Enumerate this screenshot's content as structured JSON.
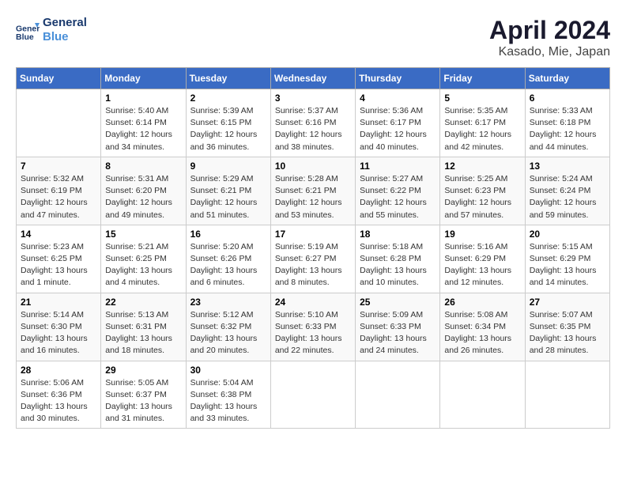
{
  "header": {
    "logo_line1": "General",
    "logo_line2": "Blue",
    "month": "April 2024",
    "location": "Kasado, Mie, Japan"
  },
  "weekdays": [
    "Sunday",
    "Monday",
    "Tuesday",
    "Wednesday",
    "Thursday",
    "Friday",
    "Saturday"
  ],
  "weeks": [
    [
      {
        "day": "",
        "info": ""
      },
      {
        "day": "1",
        "info": "Sunrise: 5:40 AM\nSunset: 6:14 PM\nDaylight: 12 hours\nand 34 minutes."
      },
      {
        "day": "2",
        "info": "Sunrise: 5:39 AM\nSunset: 6:15 PM\nDaylight: 12 hours\nand 36 minutes."
      },
      {
        "day": "3",
        "info": "Sunrise: 5:37 AM\nSunset: 6:16 PM\nDaylight: 12 hours\nand 38 minutes."
      },
      {
        "day": "4",
        "info": "Sunrise: 5:36 AM\nSunset: 6:17 PM\nDaylight: 12 hours\nand 40 minutes."
      },
      {
        "day": "5",
        "info": "Sunrise: 5:35 AM\nSunset: 6:17 PM\nDaylight: 12 hours\nand 42 minutes."
      },
      {
        "day": "6",
        "info": "Sunrise: 5:33 AM\nSunset: 6:18 PM\nDaylight: 12 hours\nand 44 minutes."
      }
    ],
    [
      {
        "day": "7",
        "info": "Sunrise: 5:32 AM\nSunset: 6:19 PM\nDaylight: 12 hours\nand 47 minutes."
      },
      {
        "day": "8",
        "info": "Sunrise: 5:31 AM\nSunset: 6:20 PM\nDaylight: 12 hours\nand 49 minutes."
      },
      {
        "day": "9",
        "info": "Sunrise: 5:29 AM\nSunset: 6:21 PM\nDaylight: 12 hours\nand 51 minutes."
      },
      {
        "day": "10",
        "info": "Sunrise: 5:28 AM\nSunset: 6:21 PM\nDaylight: 12 hours\nand 53 minutes."
      },
      {
        "day": "11",
        "info": "Sunrise: 5:27 AM\nSunset: 6:22 PM\nDaylight: 12 hours\nand 55 minutes."
      },
      {
        "day": "12",
        "info": "Sunrise: 5:25 AM\nSunset: 6:23 PM\nDaylight: 12 hours\nand 57 minutes."
      },
      {
        "day": "13",
        "info": "Sunrise: 5:24 AM\nSunset: 6:24 PM\nDaylight: 12 hours\nand 59 minutes."
      }
    ],
    [
      {
        "day": "14",
        "info": "Sunrise: 5:23 AM\nSunset: 6:25 PM\nDaylight: 13 hours\nand 1 minute."
      },
      {
        "day": "15",
        "info": "Sunrise: 5:21 AM\nSunset: 6:25 PM\nDaylight: 13 hours\nand 4 minutes."
      },
      {
        "day": "16",
        "info": "Sunrise: 5:20 AM\nSunset: 6:26 PM\nDaylight: 13 hours\nand 6 minutes."
      },
      {
        "day": "17",
        "info": "Sunrise: 5:19 AM\nSunset: 6:27 PM\nDaylight: 13 hours\nand 8 minutes."
      },
      {
        "day": "18",
        "info": "Sunrise: 5:18 AM\nSunset: 6:28 PM\nDaylight: 13 hours\nand 10 minutes."
      },
      {
        "day": "19",
        "info": "Sunrise: 5:16 AM\nSunset: 6:29 PM\nDaylight: 13 hours\nand 12 minutes."
      },
      {
        "day": "20",
        "info": "Sunrise: 5:15 AM\nSunset: 6:29 PM\nDaylight: 13 hours\nand 14 minutes."
      }
    ],
    [
      {
        "day": "21",
        "info": "Sunrise: 5:14 AM\nSunset: 6:30 PM\nDaylight: 13 hours\nand 16 minutes."
      },
      {
        "day": "22",
        "info": "Sunrise: 5:13 AM\nSunset: 6:31 PM\nDaylight: 13 hours\nand 18 minutes."
      },
      {
        "day": "23",
        "info": "Sunrise: 5:12 AM\nSunset: 6:32 PM\nDaylight: 13 hours\nand 20 minutes."
      },
      {
        "day": "24",
        "info": "Sunrise: 5:10 AM\nSunset: 6:33 PM\nDaylight: 13 hours\nand 22 minutes."
      },
      {
        "day": "25",
        "info": "Sunrise: 5:09 AM\nSunset: 6:33 PM\nDaylight: 13 hours\nand 24 minutes."
      },
      {
        "day": "26",
        "info": "Sunrise: 5:08 AM\nSunset: 6:34 PM\nDaylight: 13 hours\nand 26 minutes."
      },
      {
        "day": "27",
        "info": "Sunrise: 5:07 AM\nSunset: 6:35 PM\nDaylight: 13 hours\nand 28 minutes."
      }
    ],
    [
      {
        "day": "28",
        "info": "Sunrise: 5:06 AM\nSunset: 6:36 PM\nDaylight: 13 hours\nand 30 minutes."
      },
      {
        "day": "29",
        "info": "Sunrise: 5:05 AM\nSunset: 6:37 PM\nDaylight: 13 hours\nand 31 minutes."
      },
      {
        "day": "30",
        "info": "Sunrise: 5:04 AM\nSunset: 6:38 PM\nDaylight: 13 hours\nand 33 minutes."
      },
      {
        "day": "",
        "info": ""
      },
      {
        "day": "",
        "info": ""
      },
      {
        "day": "",
        "info": ""
      },
      {
        "day": "",
        "info": ""
      }
    ]
  ]
}
